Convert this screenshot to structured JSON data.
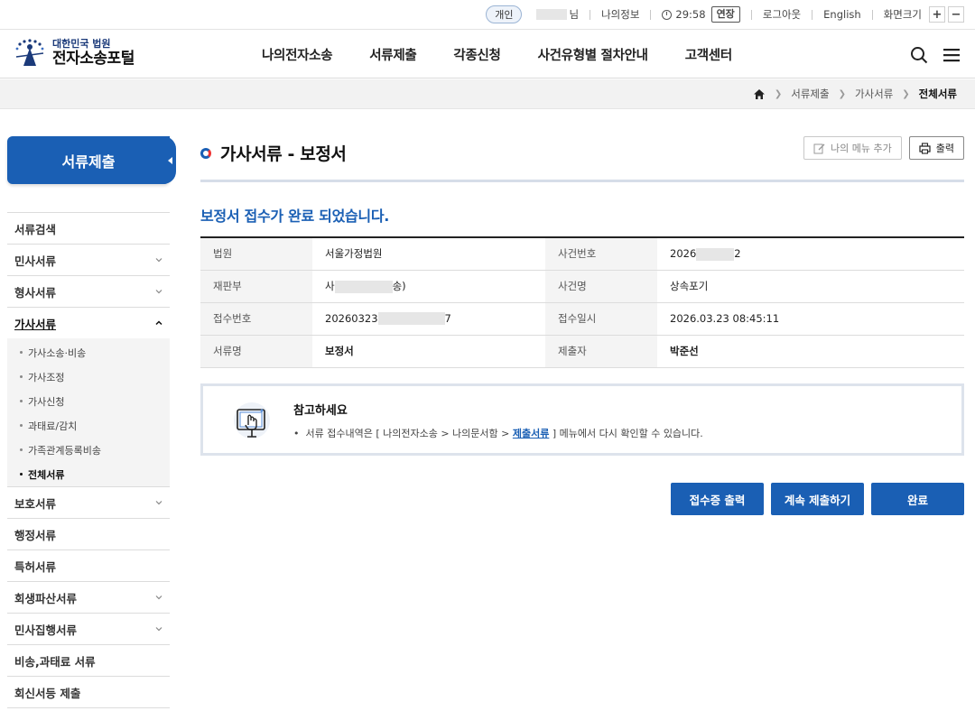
{
  "util": {
    "user_type": "개인",
    "user_suffix": "님",
    "my_info": "나의정보",
    "timer": "29:58",
    "extend": "연장",
    "logout": "로그아웃",
    "english": "English",
    "font_size": "화면크기",
    "zoom_in": "+",
    "zoom_out": "−"
  },
  "header": {
    "logo_sub": "대한민국 법원",
    "logo_main": "전자소송포털",
    "nav": [
      "나의전자소송",
      "서류제출",
      "각종신청",
      "사건유형별 절차안내",
      "고객센터"
    ]
  },
  "breadcrumb": [
    "서류제출",
    "가사서류",
    "전체서류"
  ],
  "sidebar": {
    "title": "서류제출",
    "items": [
      {
        "label": "서류검색",
        "expandable": false
      },
      {
        "label": "민사서류",
        "expandable": true
      },
      {
        "label": "형사서류",
        "expandable": true
      },
      {
        "label": "가사서류",
        "expandable": true,
        "open": true
      },
      {
        "label": "보호서류",
        "expandable": true
      },
      {
        "label": "행정서류",
        "expandable": false
      },
      {
        "label": "특허서류",
        "expandable": false
      },
      {
        "label": "회생파산서류",
        "expandable": true
      },
      {
        "label": "민사집행서류",
        "expandable": true
      },
      {
        "label": "비송,과태료 서류",
        "expandable": false
      },
      {
        "label": "회신서등 제출",
        "expandable": false
      }
    ],
    "sub_items": [
      "가사소송·비송",
      "가사조정",
      "가사신청",
      "과태료/감치",
      "가족관계등록비송",
      "전체서류"
    ],
    "active_sub": "전체서류"
  },
  "main": {
    "title": "가사서류 - 보정서",
    "my_menu_btn": "나의 메뉴 추가",
    "print_btn": "출력",
    "done_message": "보정서 접수가 완료 되었습니다.",
    "table": {
      "court_label": "법원",
      "court_value": "서울가정법원",
      "case_no_label": "사건번호",
      "case_no_prefix": "2026",
      "case_no_suffix": "2",
      "division_label": "재판부",
      "division_prefix": "사",
      "division_suffix": "송)",
      "case_name_label": "사건명",
      "case_name_value": "상속포기",
      "receipt_no_label": "접수번호",
      "receipt_no_prefix": "20260323",
      "receipt_no_suffix": "7",
      "receipt_dt_label": "접수일시",
      "receipt_dt_value": "2026.03.23 08:45:11",
      "doc_label": "서류명",
      "doc_value": "보정서",
      "submitter_label": "제출자",
      "submitter_value": "박준선"
    },
    "note": {
      "title": "참고하세요",
      "text_before": "서류 접수내역은 [ 나의전자소송 > 나의문서함 > ",
      "link": "제출서류",
      "text_after": " ] 메뉴에서 다시 확인할 수 있습니다."
    },
    "buttons": {
      "receipt_print": "접수증 출력",
      "continue": "계속 제출하기",
      "done": "완료"
    }
  },
  "colors": {
    "accent": "#1a5fb4"
  }
}
